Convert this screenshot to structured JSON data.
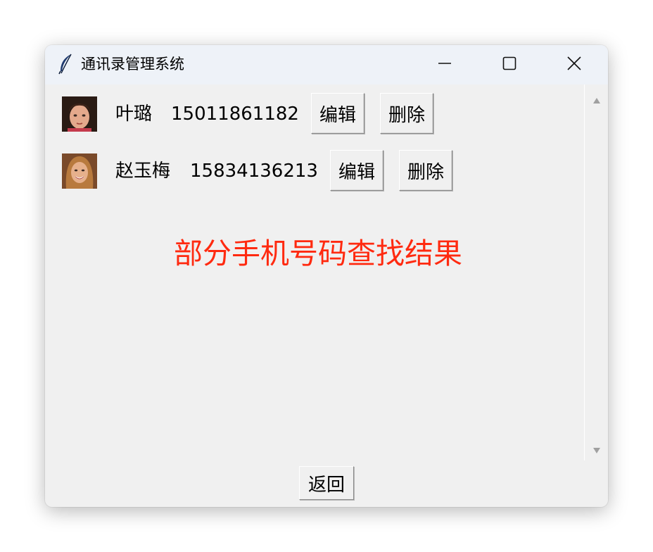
{
  "window": {
    "title": "通讯录管理系统",
    "icon": "feather-icon"
  },
  "titlebar_controls": {
    "minimize_icon": "minimize-icon",
    "maximize_icon": "maximize-icon",
    "close_icon": "close-icon"
  },
  "contacts": [
    {
      "name": "叶璐",
      "phone": "15011861182",
      "edit_label": "编辑",
      "delete_label": "删除",
      "avatar": "child-portrait"
    },
    {
      "name": "赵玉梅",
      "phone": "15834136213",
      "edit_label": "编辑",
      "delete_label": "删除",
      "avatar": "woman-portrait"
    }
  ],
  "result_heading": "部分手机号码查找结果",
  "back_label": "返回",
  "colors": {
    "heading": "#ff2a10",
    "window_bg": "#f0f0f0",
    "titlebar_bg": "#eef2f8"
  }
}
